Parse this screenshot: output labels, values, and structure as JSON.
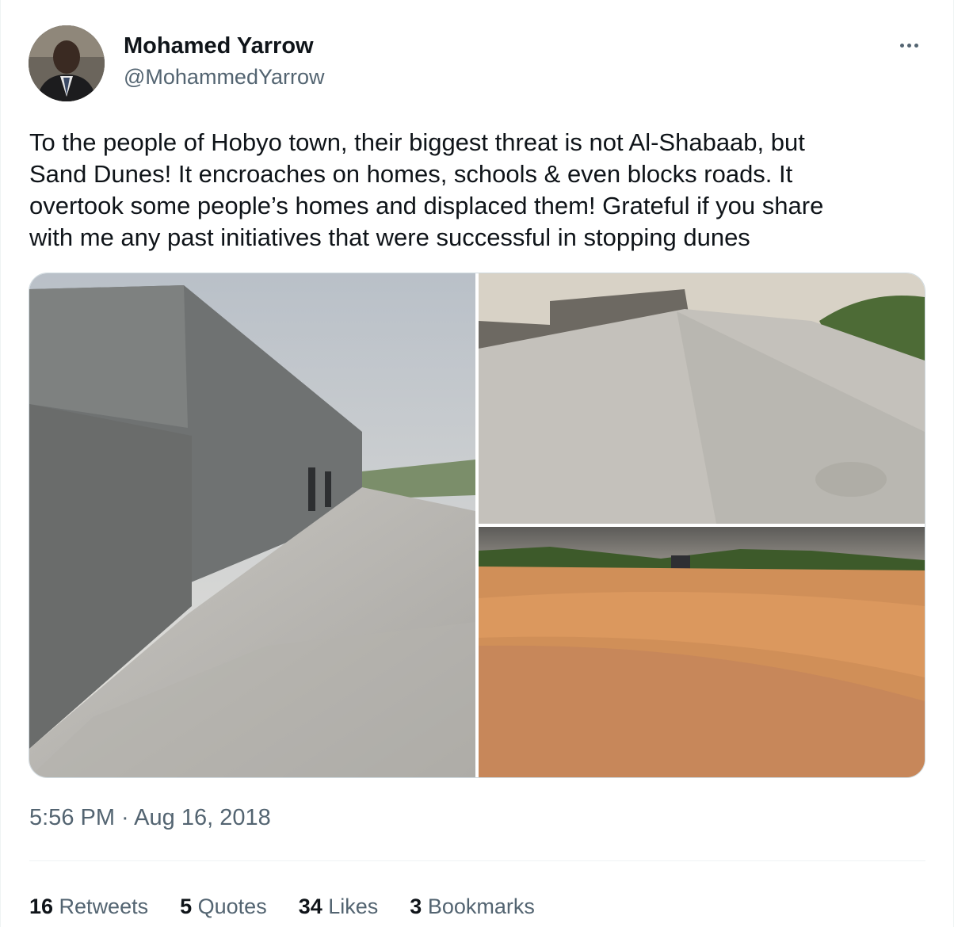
{
  "author": {
    "name": "Mohamed Yarrow",
    "handle": "@MohammedYarrow"
  },
  "tweet": {
    "text": "To the people of Hobyo town, their biggest threat is not Al-Shabaab, but\nSand Dunes! It encroaches on homes, schools & even blocks roads. It\novertook some people’s homes and displaced them! Grateful if you share\nwith me any past initiatives that were successful in stopping dunes",
    "timestamp": "5:56 PM · Aug 16, 2018"
  },
  "media": {
    "photos": [
      {
        "subject": "grey wall buried by sand dune"
      },
      {
        "subject": "sand dune covering stone wall"
      },
      {
        "subject": "orange sand dune across road"
      }
    ]
  },
  "stats": {
    "retweets": {
      "count": "16",
      "label": "Retweets"
    },
    "quotes": {
      "count": "5",
      "label": "Quotes"
    },
    "likes": {
      "count": "34",
      "label": "Likes"
    },
    "bookmarks": {
      "count": "3",
      "label": "Bookmarks"
    }
  },
  "icons": {
    "more": "more-options-icon"
  },
  "colors": {
    "text_primary": "#0f1419",
    "text_secondary": "#536471",
    "divider": "#eff3f4"
  }
}
